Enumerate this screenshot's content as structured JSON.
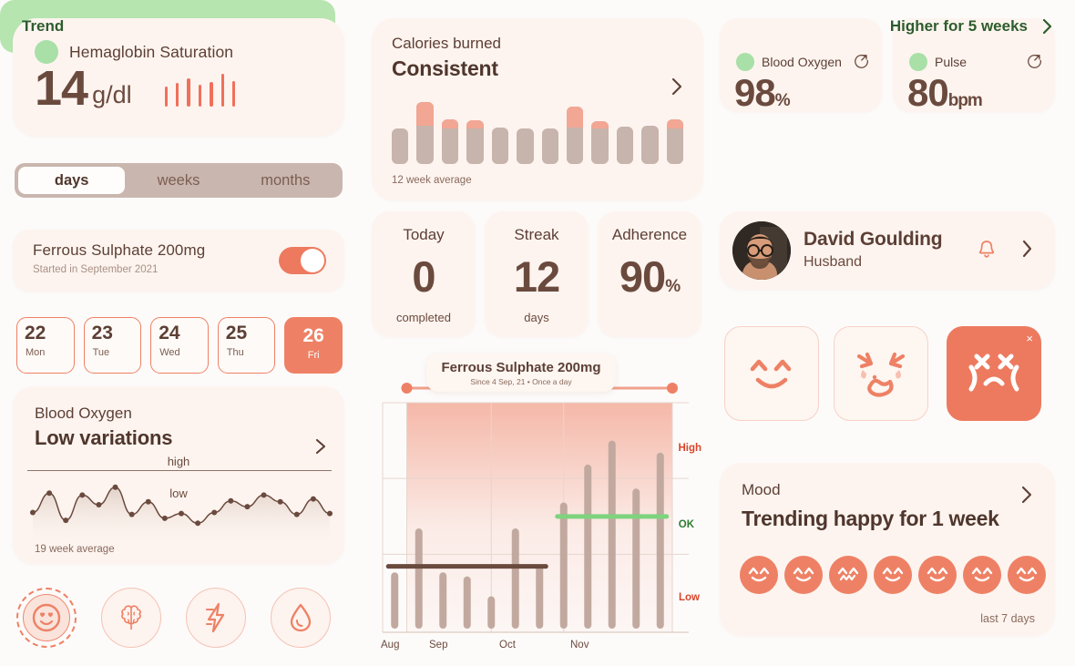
{
  "colors": {
    "bg": "#fdfbfa",
    "card": "#fdf4ef",
    "coral": "#ee8165",
    "coral_dark": "#ed7a5f",
    "brown": "#5c3f35",
    "brown_value": "#6b4a3e",
    "taupe": "#c7b4ac",
    "green_dot": "#a8e0a8",
    "green_banner": "#b6e5b0",
    "green_text": "#2d5c2d",
    "salmon": "#f2a694"
  },
  "hemoglobin": {
    "title": "Hemaglobin Saturation",
    "value": "14",
    "unit": "g/dl",
    "status_dot": "green-status-dot",
    "ticks": [
      22,
      26,
      31,
      24,
      27,
      36,
      28
    ]
  },
  "segmented": {
    "options": [
      "days",
      "weeks",
      "months"
    ],
    "selected": "days"
  },
  "medication": {
    "name": "Ferrous Sulphate 200mg",
    "subtitle": "Started in September 2021",
    "toggle_on": true
  },
  "dates": [
    {
      "num": "22",
      "dow": "Mon",
      "selected": false
    },
    {
      "num": "23",
      "dow": "Tue",
      "selected": false
    },
    {
      "num": "24",
      "dow": "Wed",
      "selected": false
    },
    {
      "num": "25",
      "dow": "Thu",
      "selected": false
    },
    {
      "num": "26",
      "dow": "Fri",
      "selected": true
    }
  ],
  "blood_oxygen_card": {
    "label": "Blood Oxygen",
    "headline": "Low variations",
    "high_label": "high",
    "low_label": "low",
    "footer": "19 week average"
  },
  "left_icons": [
    {
      "name": "smiley-heart-eyes-icon",
      "active": true
    },
    {
      "name": "brain-icon",
      "active": false
    },
    {
      "name": "lightning-bolt-icon",
      "active": false
    },
    {
      "name": "blood-drop-icon",
      "active": false
    }
  ],
  "calories": {
    "label": "Calories burned",
    "headline": "Consistent",
    "footer": "12 week average"
  },
  "stats": [
    {
      "title": "Today",
      "value": "0",
      "suffix": "",
      "footer": "completed"
    },
    {
      "title": "Streak",
      "value": "12",
      "suffix": "",
      "footer": "days"
    },
    {
      "title": "Adherence",
      "value": "90",
      "suffix": "%",
      "footer": ""
    }
  ],
  "big_chart_tooltip": {
    "title": "Ferrous Sulphate 200mg",
    "subtitle": "Since 4 Sep, 21 •  Once a day"
  },
  "big_chart_zones": {
    "high": "High",
    "ok": "OK",
    "low": "Low"
  },
  "vitals": [
    {
      "label": "Blood Oxygen",
      "value": "98",
      "unit": "%",
      "icon": "refresh-external-icon"
    },
    {
      "label": "Pulse",
      "value": "80",
      "unit": "bpm",
      "icon": "refresh-external-icon"
    }
  ],
  "trend": {
    "label": "Trend",
    "value": "Higher for 5 weeks"
  },
  "profile": {
    "name": "David Goulding",
    "relation": "Husband",
    "bell_icon": "bell-icon",
    "chevron_icon": "chevron-right-icon"
  },
  "mood_buttons": [
    {
      "name": "happy-face-button",
      "selected": false
    },
    {
      "name": "crying-face-button",
      "selected": false
    },
    {
      "name": "angry-face-button",
      "selected": true,
      "close": "×"
    }
  ],
  "mood_card": {
    "label": "Mood",
    "headline": "Trending happy for 1 week",
    "footer": "last 7 days",
    "faces": [
      "happy",
      "happy",
      "worried",
      "happy",
      "happy",
      "happy",
      "happy"
    ]
  },
  "chart_data": [
    {
      "type": "bar",
      "title": "Calories burned",
      "subtitle": "Consistent",
      "xlabel": "",
      "ylabel": "",
      "footer": "12 week average",
      "categories": [
        "1",
        "2",
        "3",
        "4",
        "5",
        "6",
        "7",
        "8",
        "9",
        "10",
        "11",
        "12"
      ],
      "values": [
        45,
        78,
        56,
        55,
        46,
        45,
        45,
        72,
        54,
        47,
        48,
        56
      ],
      "overlay_name": "above-average",
      "overlay_values": [
        0,
        30,
        11,
        10,
        0,
        0,
        0,
        26,
        9,
        0,
        0,
        11
      ],
      "base_color": "#c7b4ac",
      "overlay_color": "#f2a694",
      "grid": false,
      "legend": "none"
    },
    {
      "type": "line",
      "title": "Blood Oxygen",
      "subtitle": "Low variations",
      "footer": "19 week average",
      "annotations": [
        "high",
        "low"
      ],
      "x": [
        1,
        2,
        3,
        4,
        5,
        6,
        7,
        8,
        9,
        10,
        11,
        12,
        13,
        14,
        15,
        16,
        17,
        18,
        19
      ],
      "values": [
        22,
        42,
        14,
        40,
        30,
        48,
        20,
        33,
        16,
        21,
        11,
        22,
        34,
        28,
        40,
        33,
        20,
        36,
        21
      ],
      "ylim": [
        0,
        60
      ],
      "line_color": "#6b4a3e",
      "grid": false,
      "legend": "none"
    },
    {
      "type": "bar",
      "title": "Ferrous Sulphate 200mg",
      "subtitle": "Since 4 Sep, 21 •  Once a day",
      "xlabel": "",
      "ylabel": "",
      "categories": [
        "Aug",
        "Sep",
        "Oct",
        "Nov"
      ],
      "tick_labels": [
        "Aug",
        "Sep",
        "Oct",
        "Nov"
      ],
      "zone_labels": [
        "High",
        "OK",
        "Low"
      ],
      "x": [
        1,
        2,
        3,
        4,
        5,
        6,
        7,
        8,
        9,
        10,
        11,
        12
      ],
      "values": [
        30,
        52,
        30,
        28,
        18,
        52,
        34,
        65,
        84,
        96,
        72,
        90
      ],
      "bar_color": "#c2a99f",
      "baseline_series": [
        {
          "name": "previous-average",
          "value": 33,
          "color": "#6b4a3e",
          "x_start": 1,
          "x_end": 7
        },
        {
          "name": "current-average",
          "value": 58,
          "color": "#7ed37e",
          "x_start": 8,
          "x_end": 12
        }
      ],
      "highlight_band": {
        "label": "treatment-period",
        "x_start": 2,
        "x_end": 12,
        "color": "#ee8165"
      },
      "ylim": [
        0,
        115
      ],
      "grid": true,
      "legend": "none"
    },
    {
      "type": "bar",
      "title": "Hemaglobin Saturation ticks",
      "values": [
        22,
        26,
        31,
        24,
        27,
        36,
        28
      ],
      "bar_color": "#f0705a",
      "grid": false,
      "legend": "none"
    }
  ]
}
